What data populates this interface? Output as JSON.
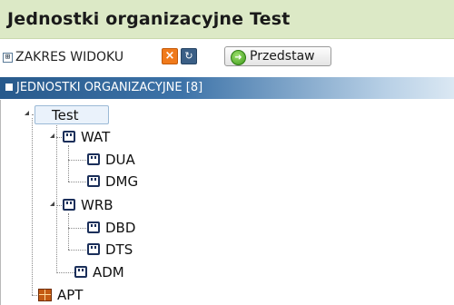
{
  "panel": {
    "title": "Jednostki organizacyjne Test"
  },
  "toolbar": {
    "expand_glyph": "⊞",
    "scope_label": "ZAKRES WIDOKU",
    "clear_glyph": "×",
    "refresh_glyph": "↻",
    "present_label": "Przedstaw",
    "present_icon": "green-arrow-icon"
  },
  "section": {
    "label": "JEDNOSTKI ORGANIZACYJNE [8]"
  },
  "tree": {
    "root": "Test",
    "groups": [
      {
        "label": "WAT",
        "children": [
          "DUA",
          "DMG"
        ]
      },
      {
        "label": "WRB",
        "children": [
          "DBD",
          "DTS"
        ]
      }
    ],
    "leaf": "ADM",
    "bottom": "APT"
  },
  "colors": {
    "title_bg": "#dce9c6",
    "section_bar": "#285a8c",
    "node_icon": "#1b2f5a",
    "clear_button": "#f07a1b",
    "apt_icon": "#c45a12"
  }
}
